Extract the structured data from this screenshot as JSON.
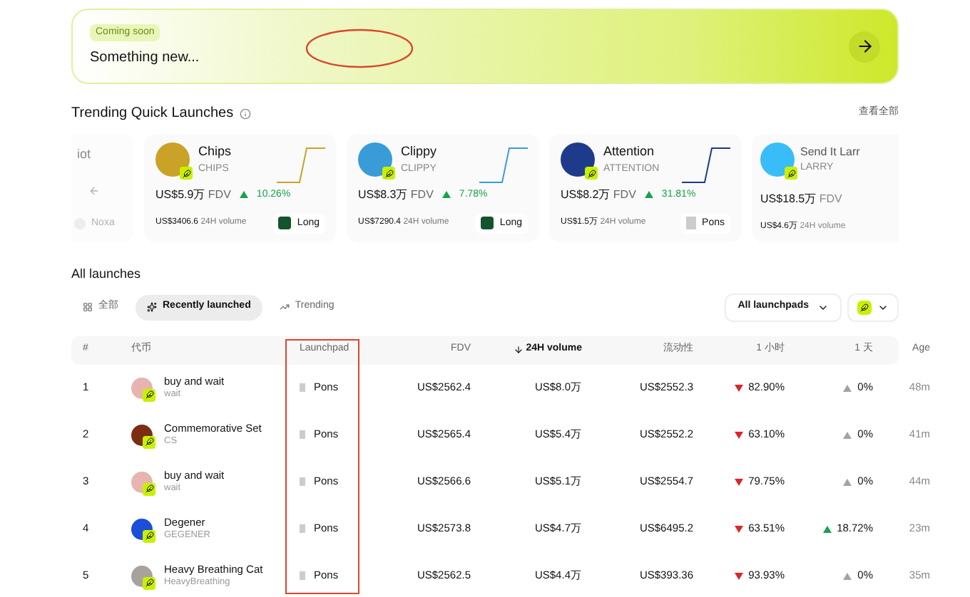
{
  "banner": {
    "badge": "Coming soon",
    "title": "Something new..."
  },
  "trending": {
    "title": "Trending Quick Launches",
    "view_all": "查看全部",
    "partial_card": {
      "name": "iot",
      "launchpad": "Noxa"
    },
    "cards": [
      {
        "name": "Chips",
        "ticker": "CHIPS",
        "fdv": "US$5.9万",
        "fdv_label": "FDV",
        "change": "10.26%",
        "volume": "US$3406.6",
        "volume_label": "24H volume",
        "launchpad": "Long",
        "color": "#c9a227"
      },
      {
        "name": "Clippy",
        "ticker": "CLIPPY",
        "fdv": "US$8.3万",
        "fdv_label": "FDV",
        "change": "7.78%",
        "volume": "US$7290.4",
        "volume_label": "24H volume",
        "launchpad": "Long",
        "color": "#3a9bd9"
      },
      {
        "name": "Attention",
        "ticker": "ATTENTION",
        "fdv": "US$8.2万",
        "fdv_label": "FDV",
        "change": "31.81%",
        "volume": "US$1.5万",
        "volume_label": "24H volume",
        "launchpad": "Pons",
        "color": "#1e3a8a"
      }
    ],
    "last_card": {
      "name": "Send It Larr",
      "ticker": "LARRY",
      "fdv": "US$18.5万",
      "fdv_label": "FDV",
      "volume": "US$4.6万",
      "volume_label": "24H volume",
      "color": "#38bdf8"
    }
  },
  "all_launches": {
    "title": "All launches",
    "tabs": [
      {
        "label": "全部",
        "selected": false
      },
      {
        "label": "Recently launched",
        "selected": true
      },
      {
        "label": "Trending",
        "selected": false
      }
    ],
    "launchpad_filter": "All launchpads",
    "columns": [
      "#",
      "代币",
      "Launchpad",
      "FDV",
      "24H volume",
      "流动性",
      "1 小时",
      "1 天",
      "Age"
    ],
    "rows": [
      {
        "rank": "1",
        "name": "buy and wait",
        "ticker": "wait",
        "launchpad": "Pons",
        "fdv": "US$2562.4",
        "volume": "US$8.0万",
        "liquidity": "US$2552.3",
        "h1": "82.90%",
        "h1_falling": true,
        "d1": "0%",
        "d1_rising": false,
        "age": "48m",
        "color": "#e8b4b0"
      },
      {
        "rank": "2",
        "name": "Commemorative Set",
        "ticker": "CS",
        "launchpad": "Pons",
        "fdv": "US$2565.4",
        "volume": "US$5.4万",
        "liquidity": "US$2552.2",
        "h1": "63.10%",
        "h1_falling": true,
        "d1": "0%",
        "d1_rising": false,
        "age": "41m",
        "color": "#7c2d12"
      },
      {
        "rank": "3",
        "name": "buy and wait",
        "ticker": "wait",
        "launchpad": "Pons",
        "fdv": "US$2566.6",
        "volume": "US$5.1万",
        "liquidity": "US$2554.7",
        "h1": "79.75%",
        "h1_falling": true,
        "d1": "0%",
        "d1_rising": false,
        "age": "44m",
        "color": "#e8b4b0"
      },
      {
        "rank": "4",
        "name": "Degener",
        "ticker": "GEGENER",
        "launchpad": "Pons",
        "fdv": "US$2573.8",
        "volume": "US$4.7万",
        "liquidity": "US$6495.2",
        "h1": "63.51%",
        "h1_falling": true,
        "d1": "18.72%",
        "d1_rising": true,
        "age": "23m",
        "color": "#1d4ed8"
      },
      {
        "rank": "5",
        "name": "Heavy Breathing Cat",
        "ticker": "HeavyBreathing",
        "launchpad": "Pons",
        "fdv": "US$2562.5",
        "volume": "US$4.4万",
        "liquidity": "US$393.36",
        "h1": "93.93%",
        "h1_falling": true,
        "d1": "0%",
        "d1_rising": false,
        "age": "35m",
        "color": "#a8a29e"
      }
    ]
  }
}
